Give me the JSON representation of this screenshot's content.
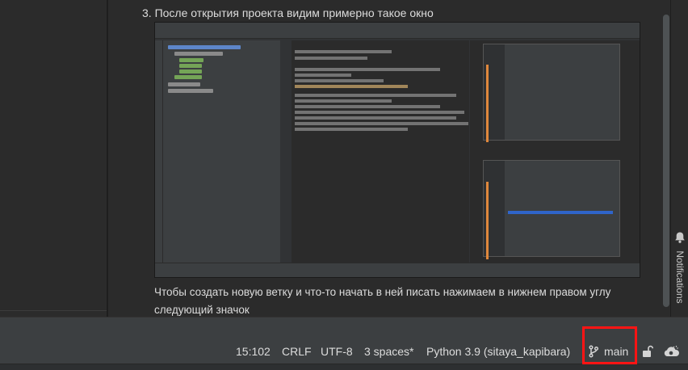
{
  "article": {
    "step_text": "3. После открытия проекта видим примерно такое окно",
    "paragraph": "Чтобы создать новую ветку и что-то начать в ней писать нажимаем в нижнем правом углу следующий значок"
  },
  "sidebar": {
    "notifications_label": "Notifications"
  },
  "status_bar": {
    "caret_position": "15:102",
    "line_separator": "CRLF",
    "encoding": "UTF-8",
    "indent": "3 spaces*",
    "interpreter": "Python 3.9 (sitaya_kapibara)",
    "branch": "main"
  },
  "colors": {
    "highlight_box": "#ff1414",
    "accent_selection": "#2f65ca",
    "orange_marker": "#e0883c"
  }
}
